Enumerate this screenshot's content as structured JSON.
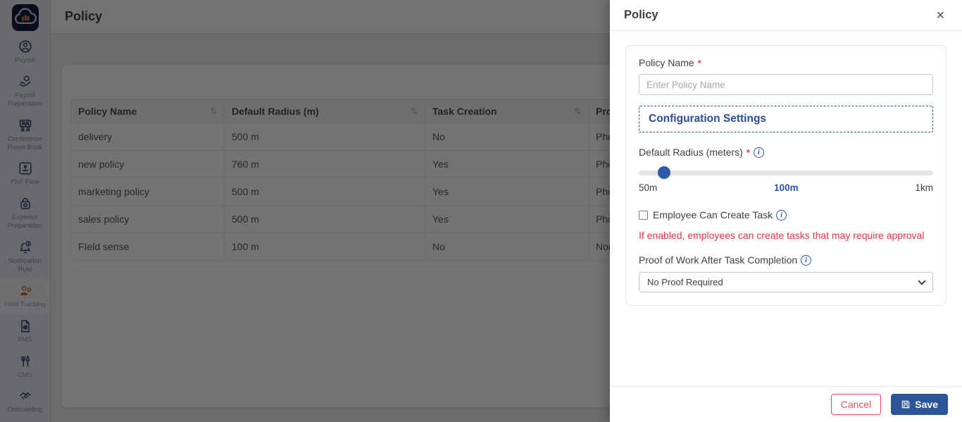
{
  "colors": {
    "accent_blue": "#2b539e",
    "save_blue": "#2b5597",
    "danger_red": "#e8304b",
    "active_icon_orange": "#c2713a",
    "logo_navy": "#16213e",
    "logo_bars_orange": "#e8913a"
  },
  "icons": {
    "close": "✕",
    "sort": "⇅",
    "info": "i"
  },
  "sidebar": {
    "items": [
      {
        "label": "Payroll"
      },
      {
        "label": "Payroll Preperation"
      },
      {
        "label": "Conference Room Book"
      },
      {
        "label": "FNF Flow"
      },
      {
        "label": "Expense Preparation"
      },
      {
        "label": "Notification Rule"
      },
      {
        "label": "Field Tracking",
        "active": true
      },
      {
        "label": "PMS"
      },
      {
        "label": "CMS"
      },
      {
        "label": "Onboarding"
      }
    ]
  },
  "header": {
    "title": "Policy"
  },
  "table": {
    "columns": [
      "Policy Name",
      "Default Radius (m)",
      "Task Creation",
      "Proo"
    ],
    "rows": [
      [
        "delivery",
        "500 m",
        "No",
        "Pho"
      ],
      [
        "new policy",
        "760 m",
        "Yes",
        "Pho"
      ],
      [
        "marketing policy",
        "500 m",
        "Yes",
        "Pho"
      ],
      [
        "sales policy",
        "500 m",
        "Yes",
        "Pho"
      ],
      [
        "FIeld sense",
        "100 m",
        "No",
        "Non"
      ]
    ]
  },
  "drawer": {
    "title": "Policy",
    "policy_name": {
      "label": "Policy Name",
      "required": "*",
      "placeholder": "Enter Policy Name",
      "value": ""
    },
    "config_heading": "Configuration Settings",
    "radius": {
      "label": "Default Radius (meters)",
      "required": "*",
      "min_label": "50m",
      "current_label": "100m",
      "max_label": "1km",
      "thumb_percent": 8.5
    },
    "task_checkbox": {
      "label": "Employee Can Create Task",
      "checked": false
    },
    "warning": "If enabled, employees can create tasks that may require approval",
    "proof": {
      "label": "Proof of Work After Task Completion",
      "selected": "No Proof Required"
    },
    "footer": {
      "cancel": "Cancel",
      "save": "Save"
    }
  }
}
